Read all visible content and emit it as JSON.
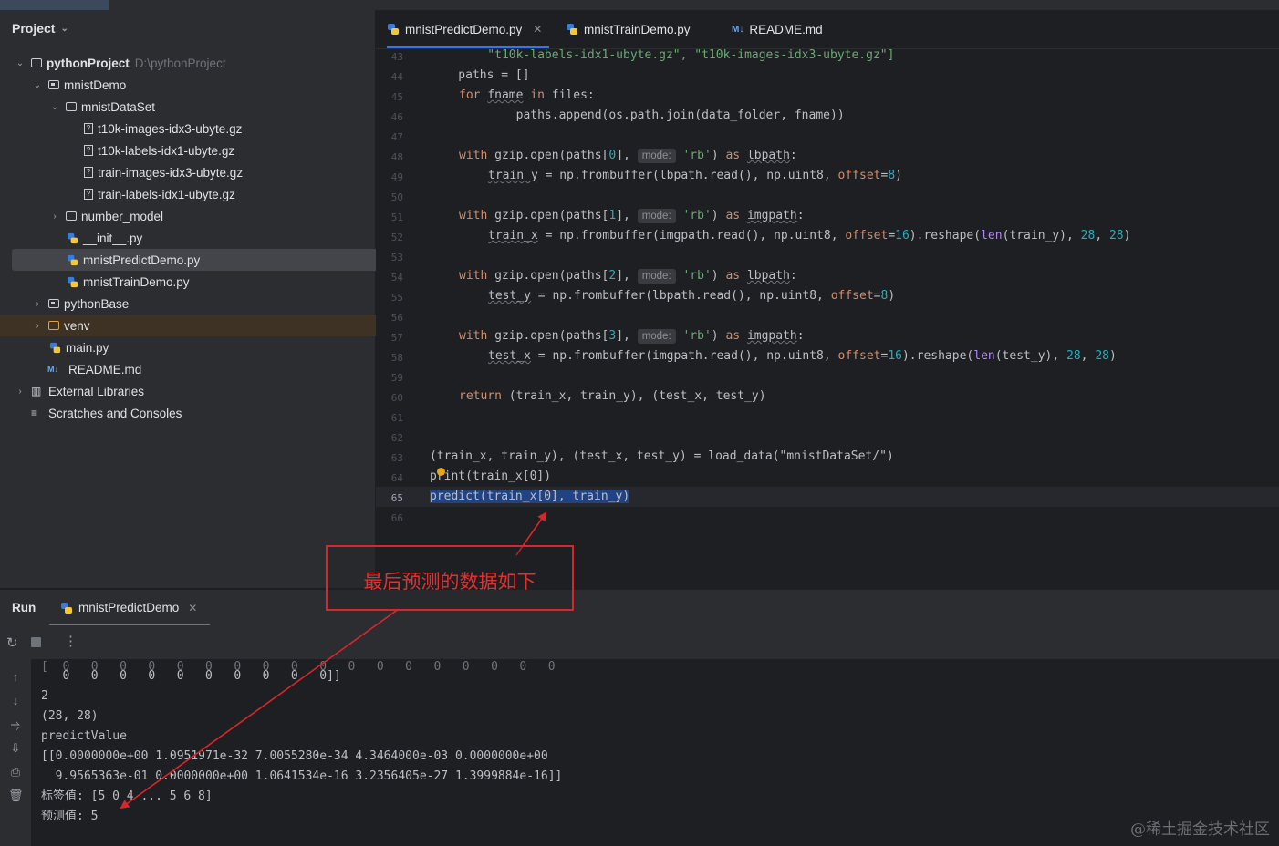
{
  "project_panel": {
    "header": "Project",
    "tree": [
      {
        "label": "pythonProject",
        "path": "D:\\pythonProject"
      },
      {
        "label": "mnistDemo"
      },
      {
        "label": "mnistDataSet"
      },
      {
        "label": "t10k-images-idx3-ubyte.gz"
      },
      {
        "label": "t10k-labels-idx1-ubyte.gz"
      },
      {
        "label": "train-images-idx3-ubyte.gz"
      },
      {
        "label": "train-labels-idx1-ubyte.gz"
      },
      {
        "label": "number_model"
      },
      {
        "label": "__init__.py"
      },
      {
        "label": "mnistPredictDemo.py"
      },
      {
        "label": "mnistTrainDemo.py"
      },
      {
        "label": "pythonBase"
      },
      {
        "label": "venv"
      },
      {
        "label": "main.py"
      },
      {
        "label": "README.md"
      },
      {
        "label": "External Libraries"
      },
      {
        "label": "Scratches and Consoles"
      }
    ]
  },
  "editor": {
    "tabs": [
      {
        "label": "mnistPredictDemo.py",
        "active": true
      },
      {
        "label": "mnistTrainDemo.py",
        "active": false
      },
      {
        "label": "README.md",
        "active": false
      }
    ],
    "md_badge": "M↓",
    "line_numbers": [
      "43",
      "44",
      "45",
      "46",
      "47",
      "48",
      "49",
      "50",
      "51",
      "52",
      "53",
      "54",
      "55",
      "56",
      "57",
      "58",
      "59",
      "60",
      "61",
      "62",
      "63",
      "64",
      "65",
      "66"
    ],
    "current_line": "65",
    "hint_mode": "mode:",
    "code": {
      "l43": "    \"t10k-labels-idx1-ubyte.gz\", \"t10k-images-idx3-ubyte.gz\"]",
      "l44": "    paths = []",
      "l45a": "for",
      "l45b": "fname",
      "l45c": "in",
      "l45d": " files:",
      "l46": "        paths.append(os.path.join(data_folder, fname))",
      "l63": "(train_x, train_y), (test_x, test_y) = load_data(\"mnistDataSet/\")",
      "l64": "print(train_x[0])",
      "l65": "predict(train_x[0], train_y)"
    }
  },
  "annotation": {
    "label": "最后预测的数据如下",
    "color": "#d8262c"
  },
  "run_panel": {
    "title": "Run",
    "tab": "mnistPredictDemo",
    "output": [
      "   0   0   0   0   0   0   0   0   0   0]]",
      "2",
      "(28, 28)",
      "predictValue",
      "[[0.0000000e+00 1.0951971e-32 7.0055280e-34 4.3464000e-03 0.0000000e+00",
      "  9.9565363e-01 0.0000000e+00 1.0641534e-16 3.2356405e-27 1.3999884e-16]]",
      "标签值: [5 0 4 ... 5 6 8]",
      "预测值: 5"
    ]
  },
  "watermark": "@稀土掘金技术社区"
}
